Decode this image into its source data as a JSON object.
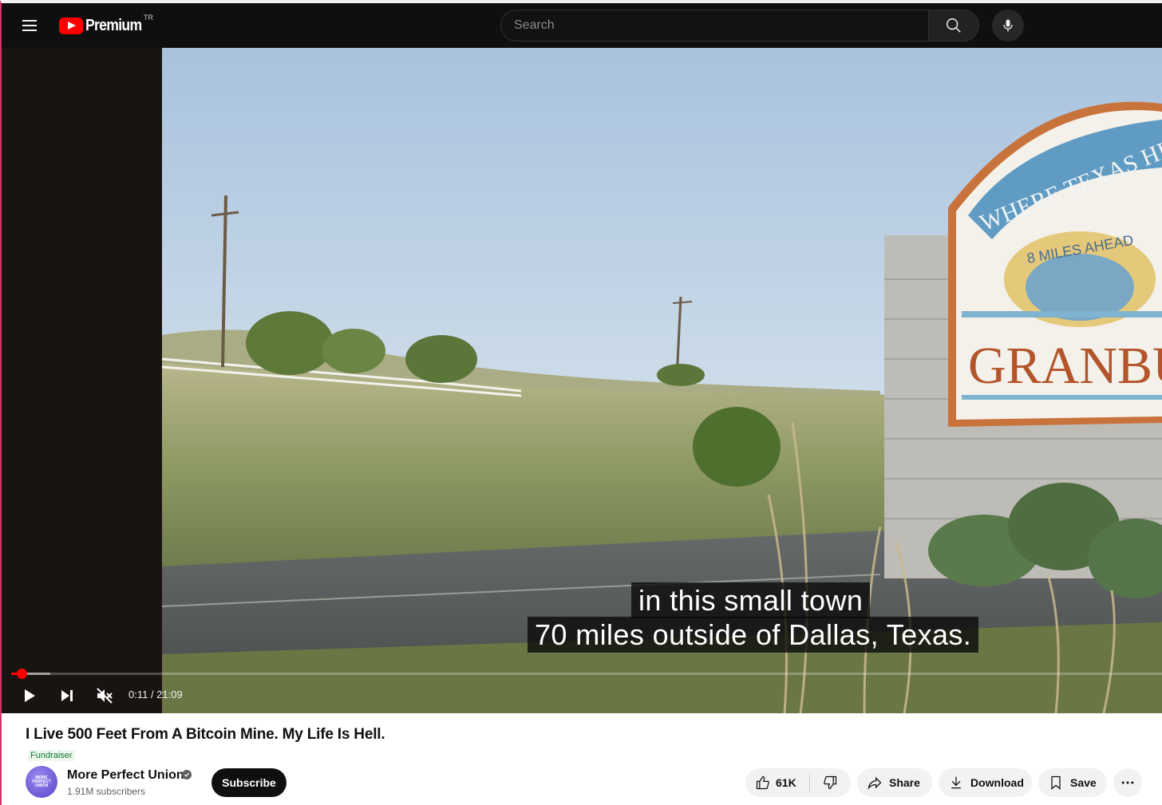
{
  "header": {
    "logo_text": "Premium",
    "region_code": "TR",
    "search_placeholder": "Search"
  },
  "player": {
    "captions": [
      "in this small town",
      "70 miles outside of Dallas, Texas."
    ],
    "current_time": "0:11",
    "duration": "21:09",
    "time_display": "0:11 / 21:09",
    "progress_fraction": 0.0087,
    "buffered_fraction": 0.034,
    "muted": true
  },
  "video": {
    "title": "I Live 500 Feet From A Bitcoin Mine. My Life Is Hell.",
    "badge": "Fundraiser"
  },
  "channel": {
    "name": "More Perfect Union",
    "subscribers": "1.91M subscribers",
    "avatar_text": "MORE PERFECT UNION",
    "verified": true
  },
  "actions": {
    "subscribe_label": "Subscribe",
    "like_count": "61K",
    "share_label": "Share",
    "download_label": "Download",
    "save_label": "Save"
  },
  "sign_lettering": {
    "banner": "WHERE TEXAS HISTORY LI",
    "ahead": "8 MILES AHEAD",
    "town": "GRANBUR"
  },
  "colors": {
    "header_bg": "#0f0f0f",
    "accent_red": "#ff0000",
    "subscribe_bg": "#0f0f0f",
    "pill_bg": "#f2f2f2",
    "badge_green": "#0c7a30"
  },
  "icons": [
    "menu-icon",
    "youtube-logo-icon",
    "search-icon",
    "mic-icon",
    "play-icon",
    "next-icon",
    "mute-icon",
    "verified-icon",
    "like-icon",
    "dislike-icon",
    "share-icon",
    "download-icon",
    "save-icon",
    "more-icon"
  ]
}
